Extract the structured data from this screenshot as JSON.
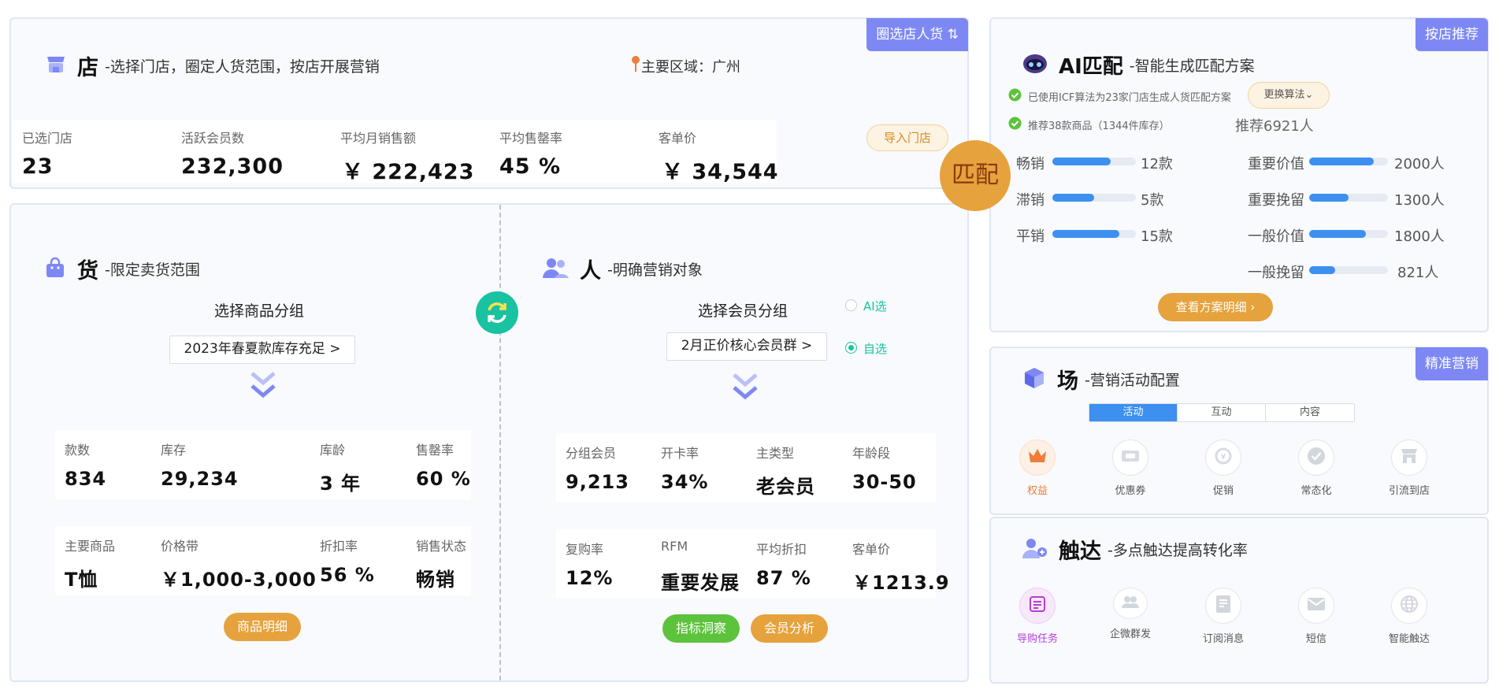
{
  "store": {
    "corner_button": "圈选店人货 ⇅",
    "title": "店",
    "subtitle": "-选择门店，圈定人货范围，按店开展营销",
    "region_label": "主要区域：广州",
    "import_button": "导入门店",
    "stats": [
      {
        "label": "已选门店",
        "value": "23"
      },
      {
        "label": "活跃会员数",
        "value": "232,300"
      },
      {
        "label": "平均月销售额",
        "value": "￥ 222,423"
      },
      {
        "label": "平均售罄率",
        "value": "45 %"
      },
      {
        "label": "客单价",
        "value": "￥ 34,544"
      }
    ]
  },
  "goods": {
    "title": "货",
    "subtitle": "-限定卖货范围",
    "group_heading": "选择商品分组",
    "group_select": "2023年春夏款库存充足 >",
    "stats_row1": [
      {
        "label": "款数",
        "value": "834"
      },
      {
        "label": "库存",
        "value": "29,234"
      },
      {
        "label": "库龄",
        "value": "3 年"
      },
      {
        "label": "售罄率",
        "value": "60 %"
      }
    ],
    "stats_row2": [
      {
        "label": "主要商品",
        "value": "T恤"
      },
      {
        "label": "价格带",
        "value": "￥1,000-3,000"
      },
      {
        "label": "折扣率",
        "value": "56 %"
      },
      {
        "label": "销售状态",
        "value": "畅销"
      }
    ],
    "detail_button": "商品明细"
  },
  "people": {
    "title": "人",
    "subtitle": "-明确营销对象",
    "group_heading": "选择会员分组",
    "group_select": "2月正价核心会员群 >",
    "radio_ai": "AI选",
    "radio_self": "自选",
    "selected_radio": "自选",
    "stats_row1": [
      {
        "label": "分组会员",
        "value": "9,213"
      },
      {
        "label": "开卡率",
        "value": "34%"
      },
      {
        "label": "主类型",
        "value": "老会员"
      },
      {
        "label": "年龄段",
        "value": "30-50"
      }
    ],
    "stats_row2": [
      {
        "label": "复购率",
        "value": "12%"
      },
      {
        "label": "RFM",
        "value": "重要发展"
      },
      {
        "label": "平均折扣",
        "value": "87 %"
      },
      {
        "label": "客单价",
        "value": "￥1213.9"
      }
    ],
    "insight_button": "指标洞察",
    "analysis_button": "会员分析"
  },
  "match_badge": "匹配",
  "ai": {
    "corner_button": "按店推荐",
    "title": "AI匹配",
    "subtitle": "-智能生成匹配方案",
    "line1": "已使用ICF算法为23家门店生成人货匹配方案",
    "change_algo": "更换算法",
    "line2": "推荐38款商品（1344件库存）",
    "recommend_people": "推荐6921人",
    "goods_bars": [
      {
        "label": "畅销",
        "value": "12款",
        "ratio": 0.7
      },
      {
        "label": "滞销",
        "value": "5款",
        "ratio": 0.5
      },
      {
        "label": "平销",
        "value": "15款",
        "ratio": 0.8
      }
    ],
    "people_bars": [
      {
        "label": "重要价值",
        "value": "2000人",
        "ratio": 0.82
      },
      {
        "label": "重要挽留",
        "value": "1300人",
        "ratio": 0.5
      },
      {
        "label": "一般价值",
        "value": "1800人",
        "ratio": 0.72
      },
      {
        "label": "一般挽留",
        "value": "821人",
        "ratio": 0.33
      }
    ],
    "plan_button": "查看方案明细 ›",
    "accent": "#3d8ff0"
  },
  "scene": {
    "corner_button": "精准营销",
    "title": "场",
    "subtitle": "-营销活动配置",
    "tabs": [
      "活动",
      "互动",
      "内容"
    ],
    "active_tab": "活动",
    "items": [
      {
        "label": "权益",
        "icon": "crown-icon"
      },
      {
        "label": "优惠券",
        "icon": "coupon-icon"
      },
      {
        "label": "促销",
        "icon": "promo-icon"
      },
      {
        "label": "常态化",
        "icon": "check-circle-icon"
      },
      {
        "label": "引流到店",
        "icon": "store-traffic-icon"
      }
    ]
  },
  "reach": {
    "title": "触达",
    "subtitle": "-多点触达提高转化率",
    "items": [
      {
        "label": "导购任务",
        "icon": "task-list-icon"
      },
      {
        "label": "企微群发",
        "icon": "group-chat-icon"
      },
      {
        "label": "订阅消息",
        "icon": "subscribe-icon"
      },
      {
        "label": "短信",
        "icon": "sms-icon"
      },
      {
        "label": "智能触达",
        "icon": "globe-icon"
      }
    ]
  },
  "colors": {
    "primary": "#7d88f5",
    "orange": "#e6a23c",
    "green": "#5dc23c",
    "teal": "#19c2a0"
  }
}
